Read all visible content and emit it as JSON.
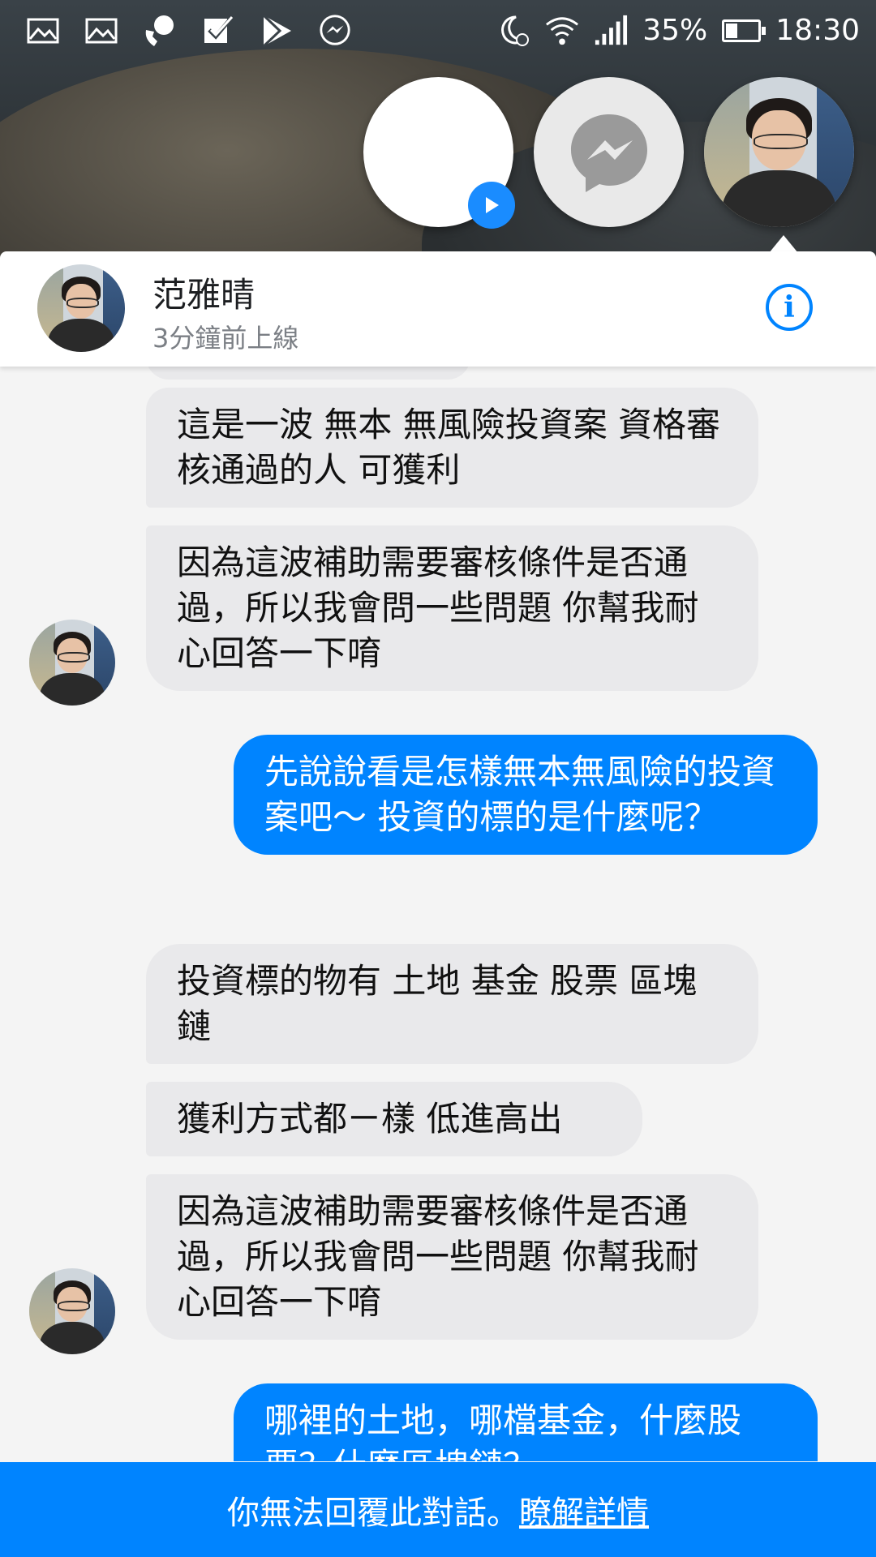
{
  "status_bar": {
    "icons_left": [
      "gallery-icon",
      "gallery-icon",
      "phone-chat-icon",
      "checkbox-icon",
      "play-store-icon",
      "messenger-icon"
    ],
    "battery_percent": "35%",
    "battery_level": 0.35,
    "time": "18:30"
  },
  "chat_heads": [
    {
      "type": "blank",
      "badge": "play-icon"
    },
    {
      "type": "messenger"
    },
    {
      "type": "contact-avatar",
      "active": true
    }
  ],
  "conversation": {
    "contact_name": "范雅晴",
    "status": "3分鐘前上線",
    "info_icon": "i"
  },
  "messages": [
    {
      "from": "them",
      "text": "這是一波 無本 無風險投資案 資格審核通過的人 可獲利"
    },
    {
      "from": "them",
      "text": "因為這波補助需要審核條件是否通過，所以我會問一些問題 你幫我耐心回答一下唷"
    },
    {
      "from": "me",
      "text": "先說說看是怎樣無本無風險的投資案吧～ 投資的標的是什麼呢？"
    },
    {
      "from": "them",
      "text": "投資標的物有 土地 基金 股票 區塊鏈"
    },
    {
      "from": "them",
      "text": "獲利方式都ㄧ樣 低進高出"
    },
    {
      "from": "them",
      "text": "因為這波補助需要審核條件是否通過，所以我會問一些問題 你幫我耐心回答一下唷"
    },
    {
      "from": "me",
      "text": "哪裡的土地，哪檔基金，什麼股票？什麼區塊鏈？"
    }
  ],
  "footer": {
    "notice": "你無法回覆此對話。",
    "link": "瞭解詳情"
  },
  "colors": {
    "accent": "#0084ff",
    "received_bubble": "#e9e9eb"
  }
}
